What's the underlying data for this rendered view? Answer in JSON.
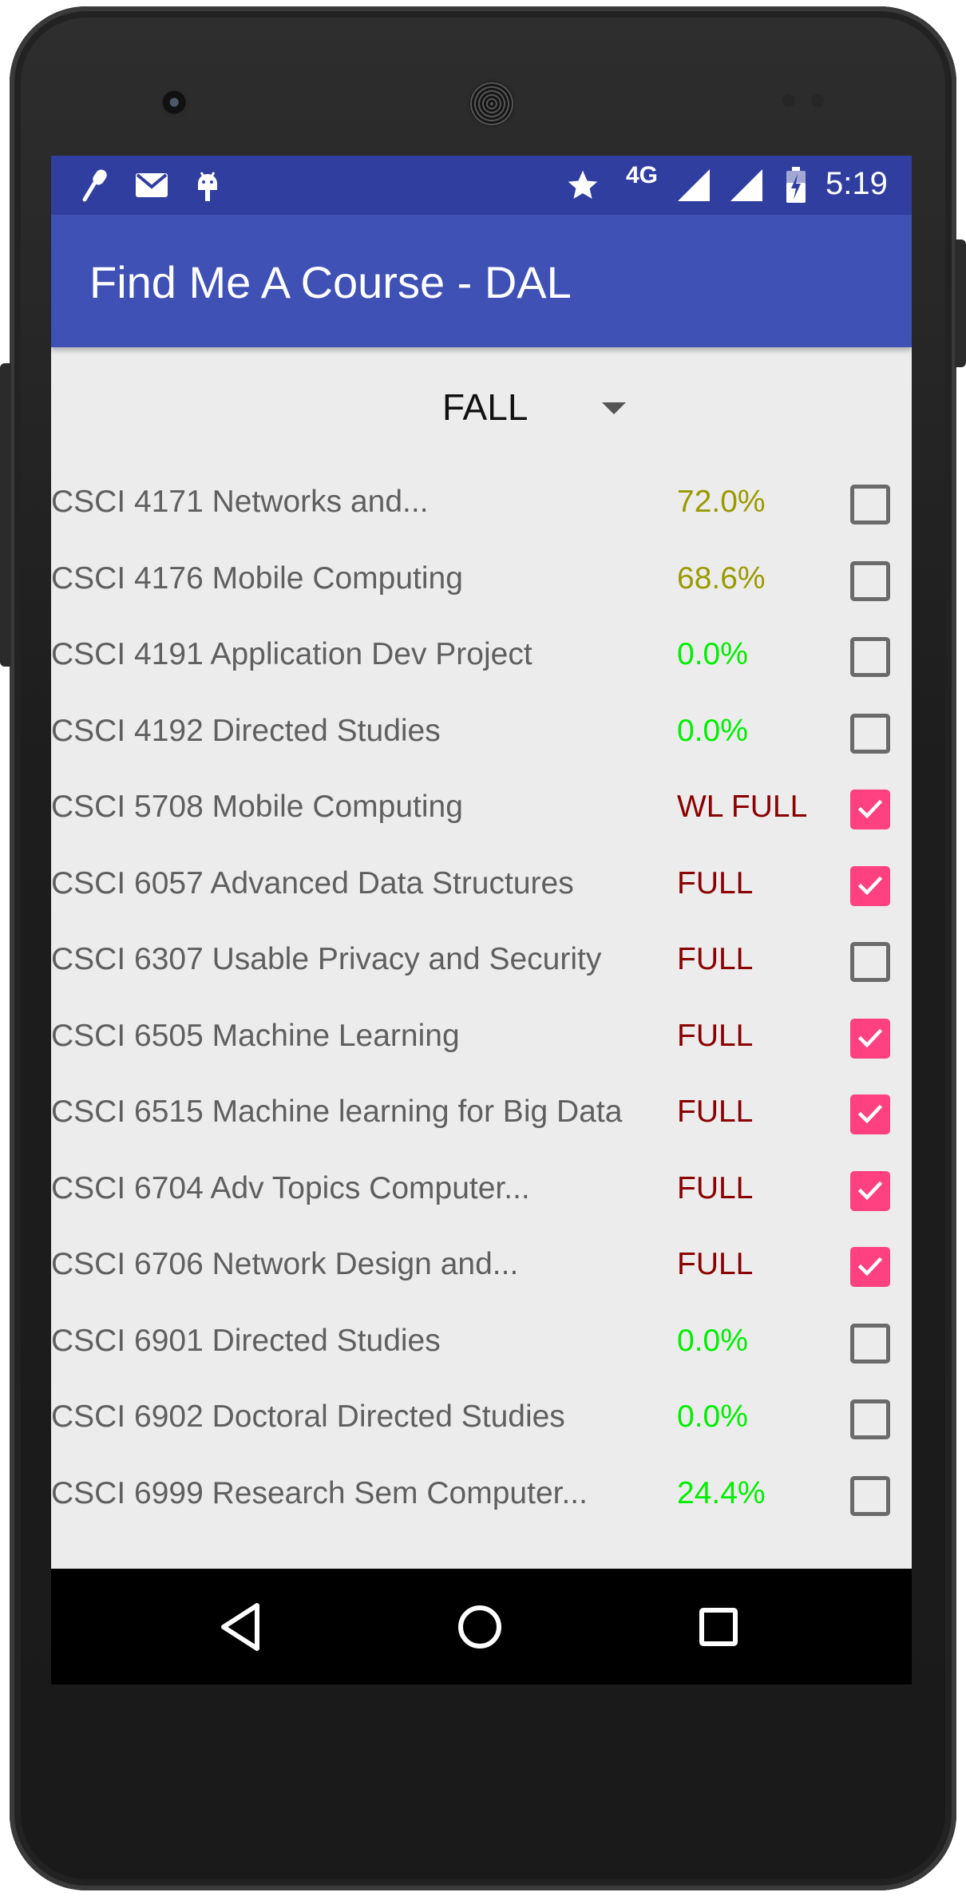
{
  "app": {
    "title": "Find Me A Course - DAL"
  },
  "status_bar": {
    "time": "5:19",
    "network": "4G",
    "left_icons": [
      "microphone-icon",
      "gmail-icon",
      "android-debug-icon"
    ],
    "right_icons": [
      "star-icon",
      "signal-icon",
      "signal-icon",
      "battery-charging-icon"
    ]
  },
  "term_spinner": {
    "selected": "FALL"
  },
  "colors": {
    "status_bar": "#303f9f",
    "app_bar": "#3f51b5",
    "checkbox_checked": "#ff4081",
    "pct_partial": "#9a9a00",
    "pct_open": "#00ee00",
    "pct_full": "#8b0000",
    "list_background": "#ececec"
  },
  "courses": [
    {
      "name": "CSCI 4171 Networks and...",
      "status": "72.0%",
      "checked": false,
      "color": "#9a9a00"
    },
    {
      "name": "CSCI 4176 Mobile Computing",
      "status": "68.6%",
      "checked": false,
      "color": "#9a9a00"
    },
    {
      "name": "CSCI 4191 Application Dev Project",
      "status": "0.0%",
      "checked": false,
      "color": "#00ee00"
    },
    {
      "name": "CSCI 4192 Directed Studies",
      "status": "0.0%",
      "checked": false,
      "color": "#00ee00"
    },
    {
      "name": "CSCI 5708 Mobile Computing",
      "status": "WL FULL",
      "checked": true,
      "color": "#8b0000"
    },
    {
      "name": "CSCI 6057 Advanced Data Structures",
      "status": "FULL",
      "checked": true,
      "color": "#8b0000"
    },
    {
      "name": "CSCI 6307 Usable Privacy and Security",
      "status": "FULL",
      "checked": false,
      "color": "#8b0000"
    },
    {
      "name": "CSCI 6505 Machine Learning",
      "status": "FULL",
      "checked": true,
      "color": "#8b0000"
    },
    {
      "name": "CSCI 6515 Machine learning for Big Data",
      "status": "FULL",
      "checked": true,
      "color": "#8b0000"
    },
    {
      "name": "CSCI 6704 Adv Topics Computer...",
      "status": "FULL",
      "checked": true,
      "color": "#8b0000"
    },
    {
      "name": "CSCI 6706 Network Design and...",
      "status": "FULL",
      "checked": true,
      "color": "#8b0000"
    },
    {
      "name": "CSCI 6901 Directed Studies",
      "status": "0.0%",
      "checked": false,
      "color": "#00ee00"
    },
    {
      "name": "CSCI 6902 Doctoral Directed Studies",
      "status": "0.0%",
      "checked": false,
      "color": "#00ee00"
    },
    {
      "name": "CSCI 6999 Research Sem Computer...",
      "status": "24.4%",
      "checked": false,
      "color": "#00ee00"
    }
  ],
  "nav_bar": {
    "buttons": [
      "back-icon",
      "home-icon",
      "recents-icon"
    ]
  }
}
